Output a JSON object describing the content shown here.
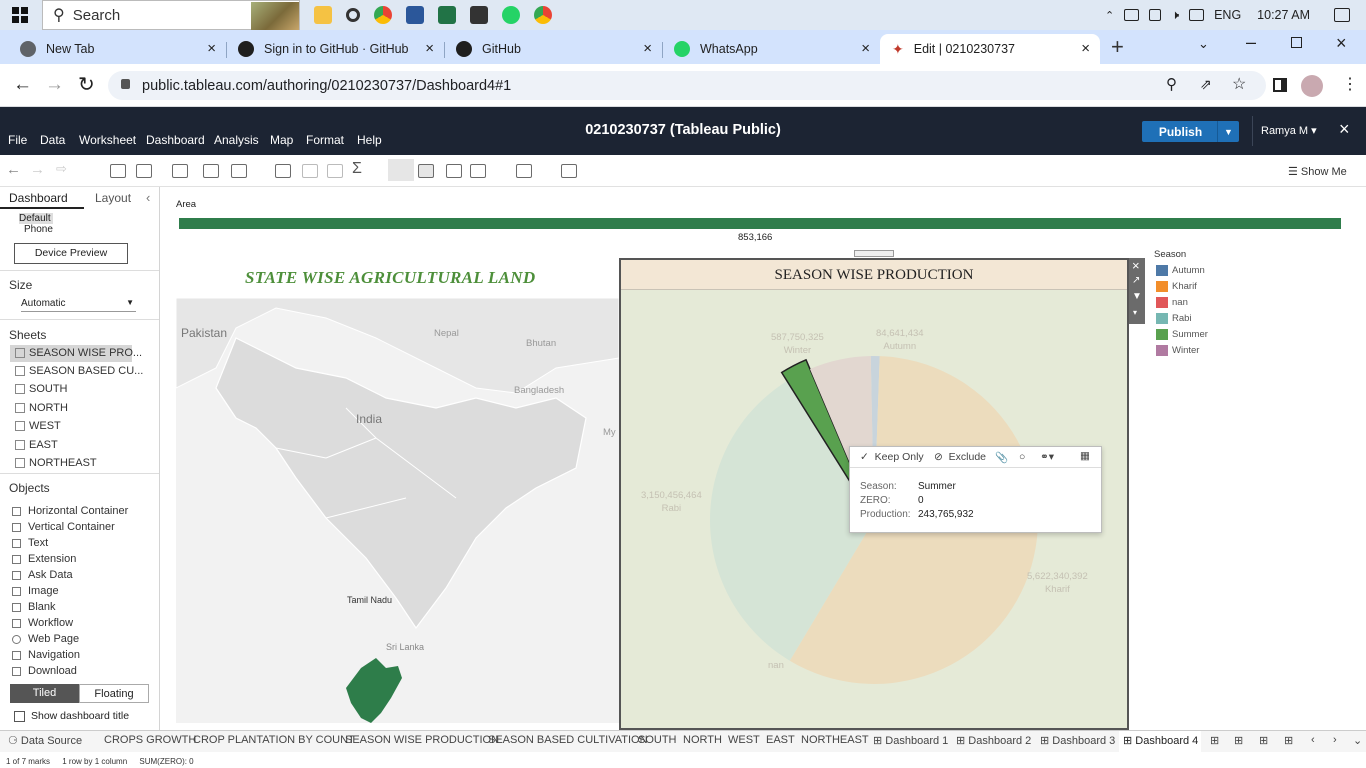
{
  "taskbar": {
    "search_placeholder": "Search",
    "language": "ENG",
    "time": "10:27 AM"
  },
  "browser": {
    "tabs": [
      {
        "label": "New Tab"
      },
      {
        "label": "Sign in to GitHub · GitHub"
      },
      {
        "label": "GitHub"
      },
      {
        "label": "WhatsApp"
      },
      {
        "label": "Edit | 0210230737"
      }
    ],
    "url": "public.tableau.com/authoring/0210230737/Dashboard4#1"
  },
  "tableau": {
    "menu": [
      "File",
      "Data",
      "Worksheet",
      "Dashboard",
      "Analysis",
      "Map",
      "Format",
      "Help"
    ],
    "title": "0210230737 (Tableau Public)",
    "publish_label": "Publish",
    "user": "Ramya M",
    "show_me": "Show Me"
  },
  "left_pane": {
    "tab_dashboard": "Dashboard",
    "tab_layout": "Layout",
    "device_default": "Default",
    "device_phone": "Phone",
    "device_preview": "Device Preview",
    "size_label": "Size",
    "size_value": "Automatic",
    "sheets_label": "Sheets",
    "sheets": [
      "SEASON WISE PRO...",
      "SEASON BASED CU...",
      "SOUTH",
      "NORTH",
      "WEST",
      "EAST",
      "NORTHEAST"
    ],
    "objects_label": "Objects",
    "objects": [
      "Horizontal Container",
      "Vertical Container",
      "Text",
      "Extension",
      "Ask Data",
      "Image",
      "Blank",
      "Workflow",
      "Web Page",
      "Navigation",
      "Download"
    ],
    "tiled": "Tiled",
    "floating": "Floating",
    "show_title": "Show dashboard title"
  },
  "dashboard": {
    "area_label": "Area",
    "area_value": "853,166",
    "map_title": "STATE WISE AGRICULTURAL LAND",
    "map_labels": [
      "Pakistan",
      "Nepal",
      "Bhutan",
      "India",
      "Bangladesh",
      "My",
      "Tamil Nadu",
      "Sri Lanka"
    ],
    "map_highlight_color": "#2e7d4a",
    "pie_title": "SEASON WISE PRODUCTION",
    "legend_title": "Season",
    "legend": [
      {
        "name": "Autumn",
        "color": "#4e79a7"
      },
      {
        "name": "Kharif",
        "color": "#f28e2b"
      },
      {
        "name": "nan",
        "color": "#e15759"
      },
      {
        "name": "Rabi",
        "color": "#76b7b2"
      },
      {
        "name": "Summer",
        "color": "#59a14f"
      },
      {
        "name": "Winter",
        "color": "#b07aa1"
      }
    ],
    "pie_labels": [
      {
        "value": "587,750,325",
        "season": "Winter"
      },
      {
        "value": "84,641,434",
        "season": "Autumn"
      },
      {
        "value": "3,150,456,464",
        "season": "Rabi"
      },
      {
        "value": "5,622,340,392",
        "season": "Kharif"
      },
      {
        "value": "",
        "season": "nan"
      }
    ]
  },
  "chart_data": {
    "type": "pie",
    "title": "SEASON WISE PRODUCTION",
    "categories": [
      "Autumn",
      "Kharif",
      "nan",
      "Rabi",
      "Summer",
      "Winter"
    ],
    "values": [
      84641434,
      5622340392,
      0,
      3150456464,
      243765932,
      587750325
    ],
    "legend": "right",
    "selected": "Summer"
  },
  "tooltip": {
    "keep_only": "Keep Only",
    "exclude": "Exclude",
    "rows": [
      {
        "key": "Season:",
        "value": "Summer"
      },
      {
        "key": "ZERO:",
        "value": "0"
      },
      {
        "key": "Production:",
        "value": "243,765,932"
      }
    ]
  },
  "bottom_tabs": [
    "Data Source",
    "CROPS GROWTH",
    "CROP PLANTATION BY COUNT",
    "SEASON WISE PRODUCTION",
    "SEASON BASED CULTIVATION",
    "SOUTH",
    "NORTH",
    "WEST",
    "EAST",
    "NORTHEAST",
    "Dashboard 1",
    "Dashboard 2",
    "Dashboard 3",
    "Dashboard 4"
  ],
  "status": {
    "marks": "1 of 7 marks",
    "rows": "1 row by 1 column",
    "sum": "SUM(ZERO): 0"
  }
}
